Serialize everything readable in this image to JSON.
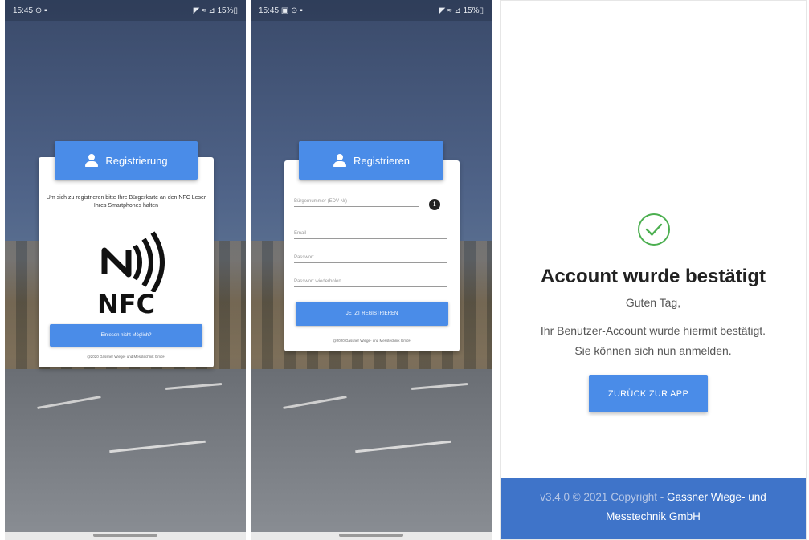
{
  "screen1": {
    "status": {
      "time": "15:45",
      "left_icons": "⊙ ▪",
      "right_icons": "◤ ≈ ⊿ 15%▯"
    },
    "header": "Registrierung",
    "instruction": "Um sich zu registrieren bitte Ihre Bürgerkarte an den NFC Leser Ihres Smartphones halten",
    "nfc_word": "NFC",
    "button": "Einlesen nicht Möglich?",
    "copyright": "@2020 Gassner Wiege- und Messtechnik GmbH"
  },
  "screen2": {
    "status": {
      "time": "15:45",
      "left_icons": "▣ ⊙ ▪",
      "right_icons": "◤ ≈ ⊿ 15%▯"
    },
    "header": "Registrieren",
    "fields": {
      "buergernummer": "Bürgernummer (EDV-Nr)",
      "email": "Email",
      "passwort": "Passwort",
      "passwort_wiederholen": "Passwort wiederholen"
    },
    "info_badge": "i",
    "button": "JETZT REGISTRIEREN",
    "copyright": "@2020 Gassner Wiege- und Messtechnik GmbH"
  },
  "screen3": {
    "title": "Account wurde bestätigt",
    "greeting": "Guten Tag,",
    "line1": "Ihr Benutzer-Account wurde hiermit bestätigt.",
    "line2": "Sie können sich nun anmelden.",
    "button": "ZURÜCK ZUR APP",
    "footer_version": "v3.4.0 © 2021 Copyright -",
    "footer_company_1": "Gassner Wiege- und",
    "footer_company_2": "Messtechnik GmbH"
  },
  "colors": {
    "accent": "#4a8ce8",
    "footer": "#3f74c9",
    "check": "#4caf50"
  }
}
